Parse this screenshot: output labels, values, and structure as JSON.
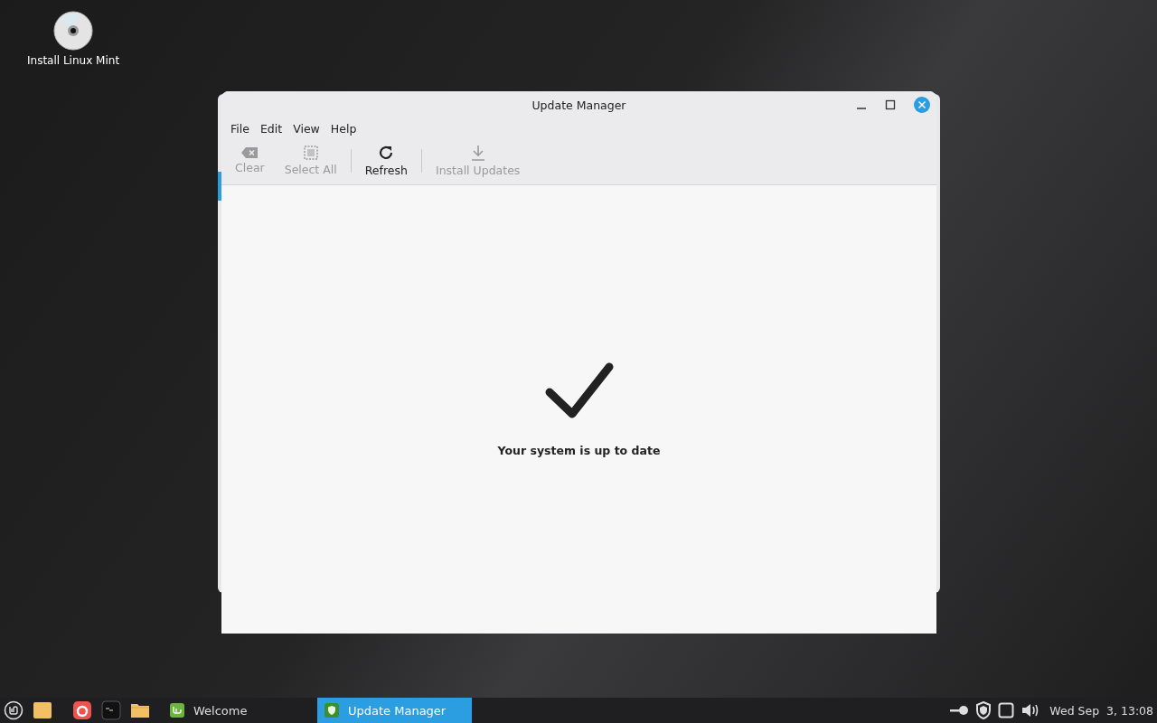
{
  "desktop_icons": [
    {
      "label": "Install Linux Mint"
    }
  ],
  "window": {
    "title": "Update Manager",
    "menu": [
      "File",
      "Edit",
      "View",
      "Help"
    ],
    "toolbar": [
      {
        "kind": "button",
        "label": "Clear",
        "disabled": true
      },
      {
        "kind": "button",
        "label": "Select All",
        "disabled": true
      },
      {
        "kind": "separator"
      },
      {
        "kind": "button",
        "label": "Refresh",
        "disabled": false
      },
      {
        "kind": "separator"
      },
      {
        "kind": "button",
        "label": "Install Updates",
        "disabled": true
      }
    ],
    "message": "Your system is up to date"
  },
  "taskbar": {
    "windows": [
      {
        "label": "Welcome",
        "selected": false
      },
      {
        "label": "Update Manager",
        "selected": true
      }
    ],
    "clock": "Wed Sep  3, 13:08"
  }
}
